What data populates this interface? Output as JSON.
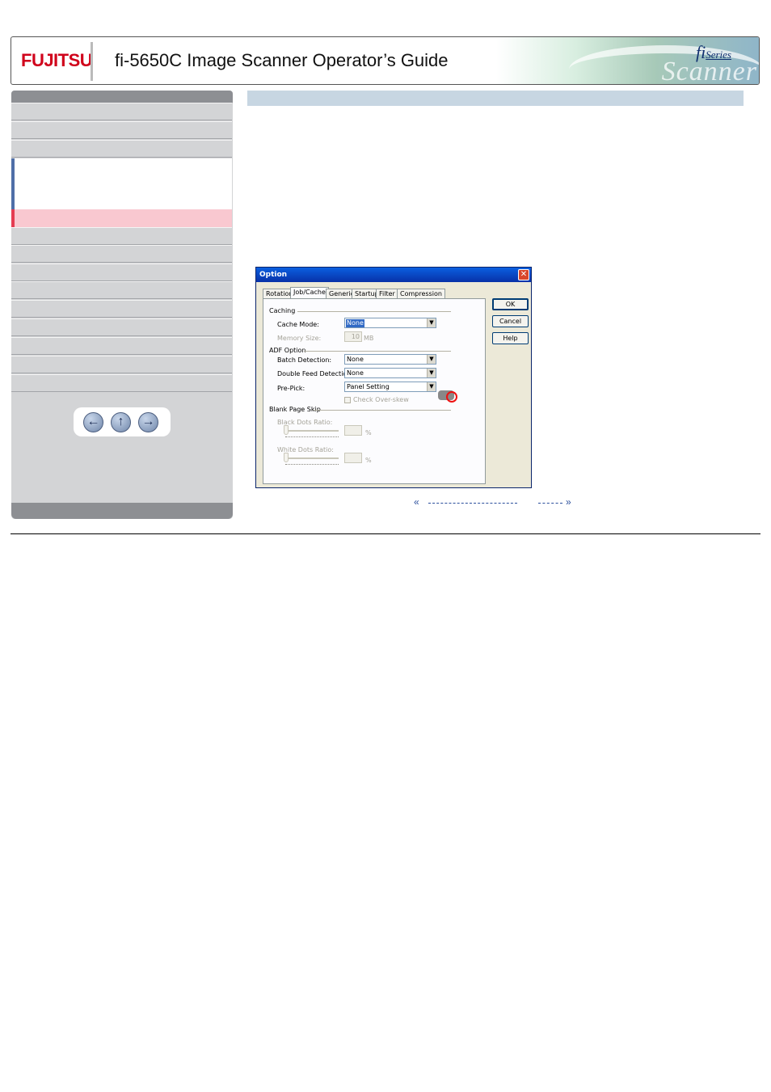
{
  "header": {
    "logo_text": "FUJITSU",
    "title": "fi-5650C Image Scanner Operator’s Guide",
    "series_prefix": "fi",
    "series_suffix": "Series",
    "art_word": "Scanner"
  },
  "sidebar": {
    "nav_buttons": [
      {
        "icon": "arrow-left-icon",
        "glyph": "←"
      },
      {
        "icon": "arrow-up-icon",
        "glyph": "↑"
      },
      {
        "icon": "arrow-right-icon",
        "glyph": "→"
      }
    ]
  },
  "dialog": {
    "title": "Option",
    "close_glyph": "✕",
    "tabs": [
      "Rotation",
      "Job/Cache",
      "Generic",
      "Startup",
      "Filter",
      "Compression"
    ],
    "active_tab": "Job/Cache",
    "groups": {
      "caching": "Caching",
      "adf_option": "ADF Option",
      "blank_page_skip": "Blank Page Skip"
    },
    "fields": {
      "cache_mode_label": "Cache Mode:",
      "cache_mode_value": "None",
      "memory_size_label": "Memory Size:",
      "memory_size_value": "10",
      "memory_size_unit": "MB",
      "batch_detection_label": "Batch Detection:",
      "batch_detection_value": "None",
      "double_feed_label": "Double Feed Detection:",
      "double_feed_value": "None",
      "pre_pick_label": "Pre-Pick:",
      "pre_pick_value": "Panel Setting",
      "check_overskew_label": "Check Over-skew",
      "black_dots_label": "Black Dots Ratio:",
      "black_dots_value": "",
      "white_dots_label": "White Dots Ratio:",
      "white_dots_value": "",
      "percent": "%"
    },
    "buttons": {
      "ok": "OK",
      "cancel": "Cancel",
      "help": "Help"
    }
  },
  "page_nav": {
    "prev_glyph": "«",
    "next_glyph": "»"
  },
  "colors": {
    "brand_red": "#d0021b",
    "active_nav": "#f9c8d0",
    "active_nav_marker": "#e53c52",
    "expanded_nav_marker": "#4f6fa8",
    "content_bar": "#c7d6e2",
    "link_blue": "#2b4f9c"
  }
}
